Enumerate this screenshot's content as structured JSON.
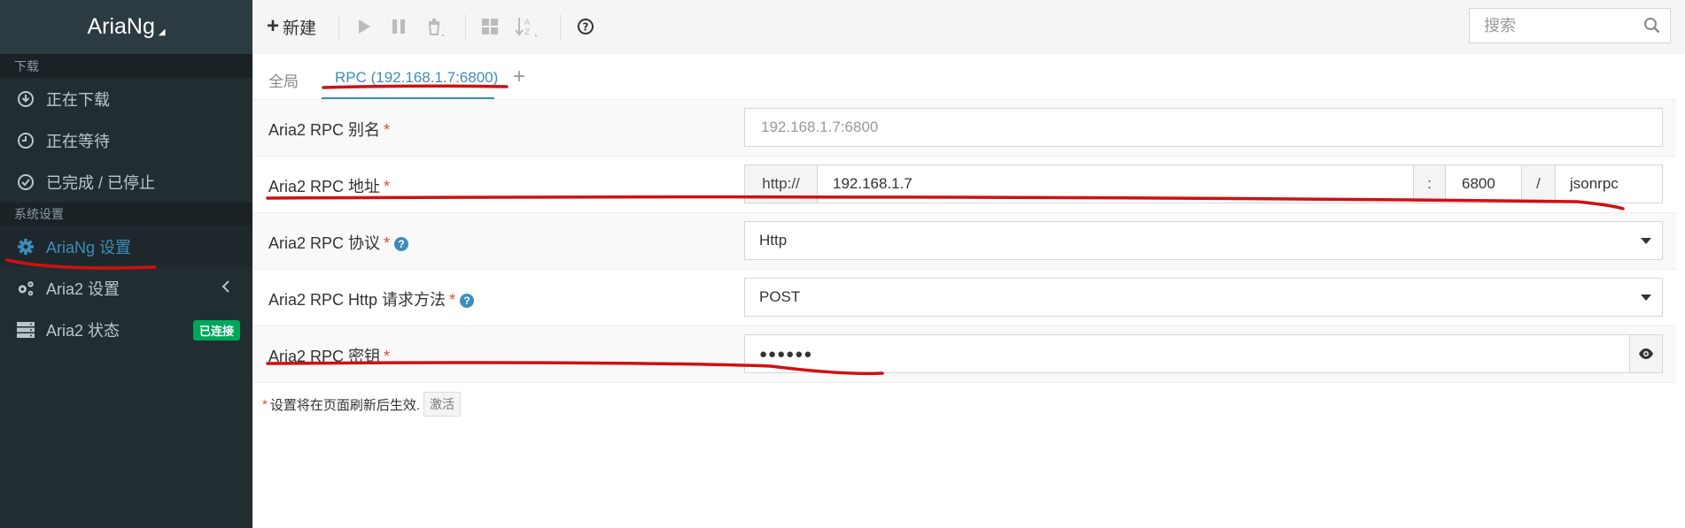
{
  "app": {
    "brand": "AriaNg",
    "brand_caret": "◢"
  },
  "sidebar": {
    "section_download": "下载",
    "section_settings": "系统设置",
    "items": [
      {
        "label": "正在下载",
        "icon": "download-circle-icon"
      },
      {
        "label": "正在等待",
        "icon": "clock-icon"
      },
      {
        "label": "已完成 / 已停止",
        "icon": "check-circle-icon"
      },
      {
        "label": "AriaNg 设置",
        "icon": "gear-icon",
        "active": true
      },
      {
        "label": "Aria2 设置",
        "icon": "gears-icon"
      },
      {
        "label": "Aria2 状态",
        "icon": "server-icon",
        "badge": "已连接"
      }
    ]
  },
  "toolbar": {
    "new_label": "新建",
    "search_placeholder": "搜索"
  },
  "tabs": {
    "global": "全局",
    "rpc": "RPC (192.168.1.7:6800)",
    "add": "+"
  },
  "settings": {
    "alias": {
      "label": "Aria2 RPC 别名",
      "required": "*",
      "placeholder": "192.168.1.7:6800"
    },
    "address": {
      "label": "Aria2 RPC 地址",
      "required": "*",
      "protocol_prefix": "http://",
      "host": "192.168.1.7",
      "colon": ":",
      "port": "6800",
      "slash": "/",
      "interface": "jsonrpc"
    },
    "protocol": {
      "label": "Aria2 RPC 协议",
      "required": "*",
      "help": "?",
      "value": "Http"
    },
    "method": {
      "label": "Aria2 RPC Http 请求方法",
      "required": "*",
      "help": "?",
      "value": "POST"
    },
    "secret": {
      "label": "Aria2 RPC 密钥",
      "required": "*",
      "value": "●●●●●●"
    }
  },
  "note": {
    "required": "*",
    "text": "设置将在页面刷新后生效.",
    "activate_label": "激活"
  },
  "colors": {
    "sidebar_bg": "#222d32",
    "accent": "#3c8dbc",
    "required": "#dd4b39",
    "badge_green": "#00a65a",
    "annotation_red": "#d01010"
  }
}
